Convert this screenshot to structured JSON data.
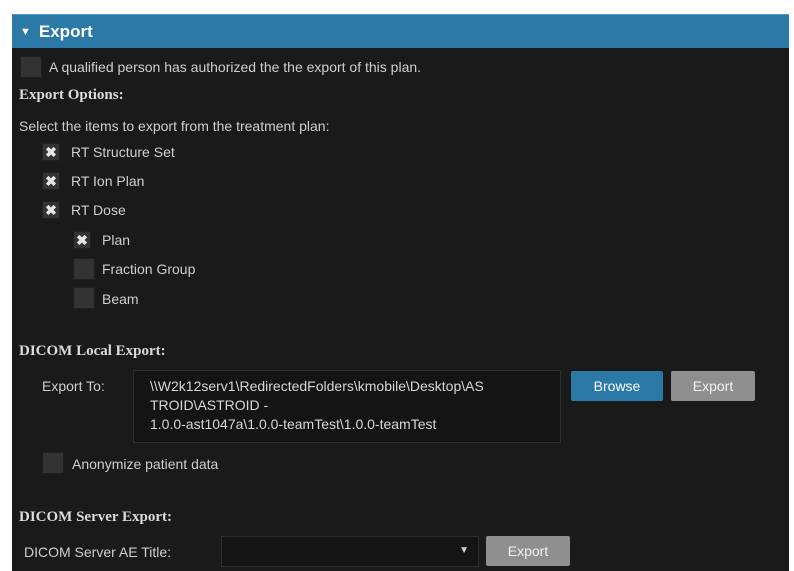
{
  "header": {
    "title": "Export"
  },
  "authorization": {
    "label": "A qualified person has authorized the the export of this plan.",
    "checked": false
  },
  "export_options": {
    "heading": "Export Options:",
    "instruction": "Select the items to export from the treatment plan:",
    "items": [
      {
        "label": "RT Structure Set",
        "checked": true
      },
      {
        "label": "RT Ion Plan",
        "checked": true
      },
      {
        "label": "RT Dose",
        "checked": true
      },
      {
        "label": "Plan",
        "checked": true
      },
      {
        "label": "Fraction Group",
        "checked": false
      },
      {
        "label": "Beam",
        "checked": false
      }
    ]
  },
  "local_export": {
    "heading": "DICOM Local Export:",
    "export_to_label": "Export To:",
    "path_lines": [
      "\\\\W2k12serv1\\RedirectedFolders\\kmobile\\Desktop\\AS",
      "TROID\\ASTROID -",
      "1.0.0-ast1047a\\1.0.0-teamTest\\1.0.0-teamTest"
    ],
    "browse_label": "Browse",
    "export_label": "Export",
    "anonymize_label": "Anonymize patient data",
    "anonymize_checked": false
  },
  "server_export": {
    "heading": "DICOM Server Export:",
    "ae_title_label": "DICOM Server AE Title:",
    "ae_title_value": "",
    "export_label": "Export"
  },
  "colors": {
    "header": "#2a79a6",
    "panel": "#1a1a1a",
    "primary_button": "#2a79a6",
    "disabled_button": "#8f8f8f"
  }
}
